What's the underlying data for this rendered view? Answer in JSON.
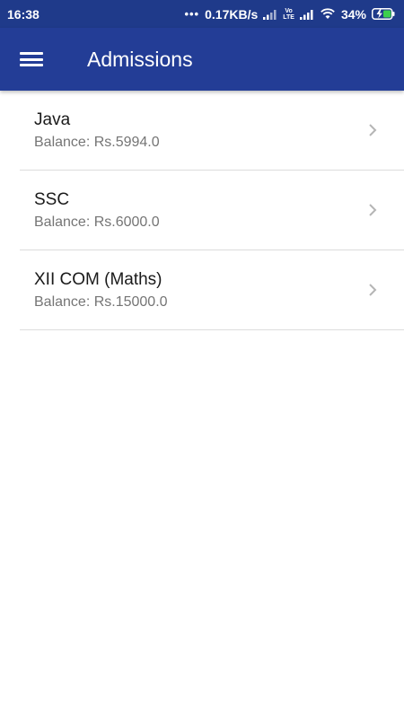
{
  "status_bar": {
    "time": "16:38",
    "dots": "•••",
    "speed": "0.17KB/s",
    "volte_top": "Vo",
    "volte_bottom": "LTE",
    "battery": "34%"
  },
  "app_bar": {
    "title": "Admissions"
  },
  "admissions": [
    {
      "name": "Java",
      "balance": "Balance: Rs.5994.0"
    },
    {
      "name": "SSC",
      "balance": "Balance: Rs.6000.0"
    },
    {
      "name": "XII COM (Maths)",
      "balance": "Balance: Rs.15000.0"
    }
  ],
  "colors": {
    "status_bar": "#1f3a8a",
    "app_bar": "#233d96",
    "battery_charge": "#3ccf4e"
  },
  "icons": [
    "menu-icon",
    "chevron-right-icon",
    "signal-icon",
    "wifi-icon",
    "battery-charging-icon"
  ]
}
